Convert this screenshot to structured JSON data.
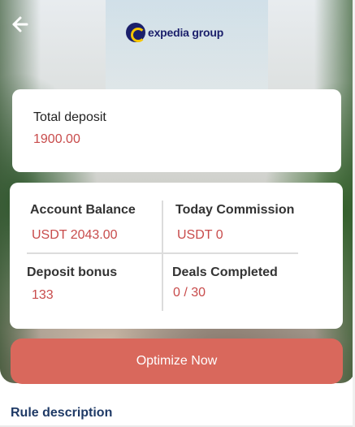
{
  "header": {
    "back_icon": "arrow-left-icon",
    "logo_text": "expedia group"
  },
  "deposit": {
    "label": "Total deposit",
    "value": "1900.00"
  },
  "stats": {
    "account_balance": {
      "label": "Account Balance",
      "value": "USDT 2043.00"
    },
    "today_commission": {
      "label": "Today Commission",
      "value": "USDT 0"
    },
    "deposit_bonus": {
      "label": "Deposit bonus",
      "value": "133"
    },
    "deals_completed": {
      "label": "Deals Completed",
      "value": "0 / 30"
    }
  },
  "actions": {
    "optimize_label": "Optimize Now"
  },
  "rules": {
    "title": "Rule description"
  },
  "colors": {
    "accent": "#d9685c",
    "value_text": "#c84b4b",
    "logo": "#1b1f6b"
  }
}
